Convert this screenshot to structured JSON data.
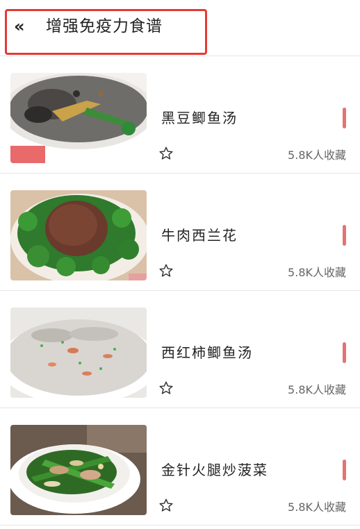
{
  "header": {
    "back_icon": "«",
    "title": "增强免疫力食谱"
  },
  "recipes": [
    {
      "name": "黑豆鲫鱼汤",
      "favorites": "5.8K人收藏",
      "image": "black-bean-crucian-soup"
    },
    {
      "name": "牛肉西兰花",
      "favorites": "5.8K人收藏",
      "image": "beef-broccoli"
    },
    {
      "name": "西红柿鲫鱼汤",
      "favorites": "5.8K人收藏",
      "image": "tomato-crucian-soup"
    },
    {
      "name": "金针火腿炒菠菜",
      "favorites": "5.8K人收藏",
      "image": "enoki-ham-spinach"
    }
  ],
  "colors": {
    "accent": "#e57373",
    "highlight_box": "#e53935"
  }
}
